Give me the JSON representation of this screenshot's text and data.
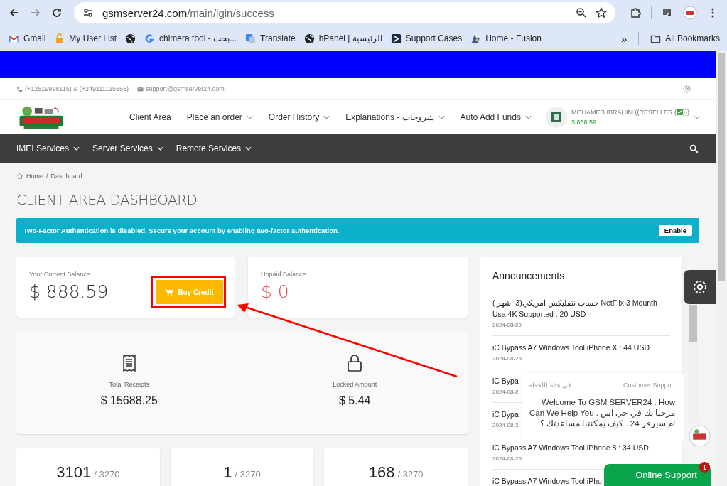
{
  "browser": {
    "url_host": "gsmserver24.com",
    "url_path": "/main/lgin/success",
    "bookmarks": [
      {
        "kind": "gmail",
        "label": "Gmail"
      },
      {
        "kind": "lock",
        "label": "My User List"
      },
      {
        "kind": "globe"
      },
      {
        "kind": "google",
        "label": "chimera tool - بحث..."
      },
      {
        "kind": "translate",
        "label": "Translate"
      },
      {
        "kind": "globe",
        "label": "hPanel | الرئيسية"
      },
      {
        "kind": "support",
        "label": "Support Cases"
      },
      {
        "kind": "fusion",
        "label": "Home - Fusion"
      }
    ],
    "more": "»",
    "all_bookmarks": "All Bookmarks"
  },
  "topbar": {
    "phone": "(+12519998115) & (+249111125555)",
    "email": "support@gsmserver24.com"
  },
  "header": {
    "nav": [
      {
        "label": "Client Area",
        "has_menu": false
      },
      {
        "label": "Place an order",
        "has_menu": true
      },
      {
        "label": "Order History",
        "has_menu": true
      },
      {
        "label": "Explanations - شروحات",
        "has_menu": true
      },
      {
        "label": "Auto Add Funds",
        "has_menu": true
      }
    ],
    "user": {
      "name_before": "MOHAMED IBRAHIM ((RESELLER (",
      "name_after": ")))",
      "balance": "$ 888.59"
    }
  },
  "services_nav": [
    "IMEI Services",
    "Server Services",
    "Remote Services"
  ],
  "breadcrumb": {
    "items": [
      "Home",
      "Dashboard"
    ],
    "separator": "/"
  },
  "page_title": "CLIENT AREA DASHBOARD",
  "alert": {
    "message": "Two-Factor Authentication is disabled. Secure your account by enabling two-factor authentication.",
    "button": "Enable"
  },
  "balance": {
    "label": "Your Current Balance",
    "value": "$ 888.59",
    "button": "Buy Credit"
  },
  "unpaid": {
    "label": "Unpaid Balance",
    "value": "$ 0"
  },
  "stats": [
    {
      "kind": "receipt",
      "label": "Total Receipts",
      "value": "$ 15688.25"
    },
    {
      "kind": "lock",
      "label": "Locked Amount",
      "value": "$ 5.44"
    }
  ],
  "counters": [
    {
      "value": "3101",
      "total": "/ 3270"
    },
    {
      "value": "1",
      "total": "/ 3270"
    },
    {
      "value": "168",
      "total": "/ 3270"
    }
  ],
  "announcements": {
    "title": "Announcements",
    "items": [
      {
        "title": "حساب نتفليكس امريكي(3 اشهر ) NetFlix 3 Mounth Usa 4K Supported : 20 USD",
        "date": "2024-08-29"
      },
      {
        "title": "iC Bypass A7 Windows Tool iPhone X : 44 USD",
        "date": "2024-08-29"
      },
      {
        "title": "iC Bypa",
        "date": "2024-08-2"
      },
      {
        "title": "iC Bypa",
        "date": "2024-08-2"
      },
      {
        "title": "iC Bypass A7 Windows Tool iPhone 8 : 34 USD",
        "date": "2024-08-29"
      },
      {
        "title": "iC Bypass A7 Windows Tool iPho"
      }
    ]
  },
  "chat": {
    "time": "في هذه اللحظة",
    "agent": "Customer Support",
    "message": "Welcome To GSM SERVER24 . How Can We Help You . مرحبا بك في جي اس ام سيرفر 24 . كيف يمكنتنا مساعدتك ؟"
  },
  "online_support": {
    "label": "Online Support",
    "badge": "1"
  }
}
